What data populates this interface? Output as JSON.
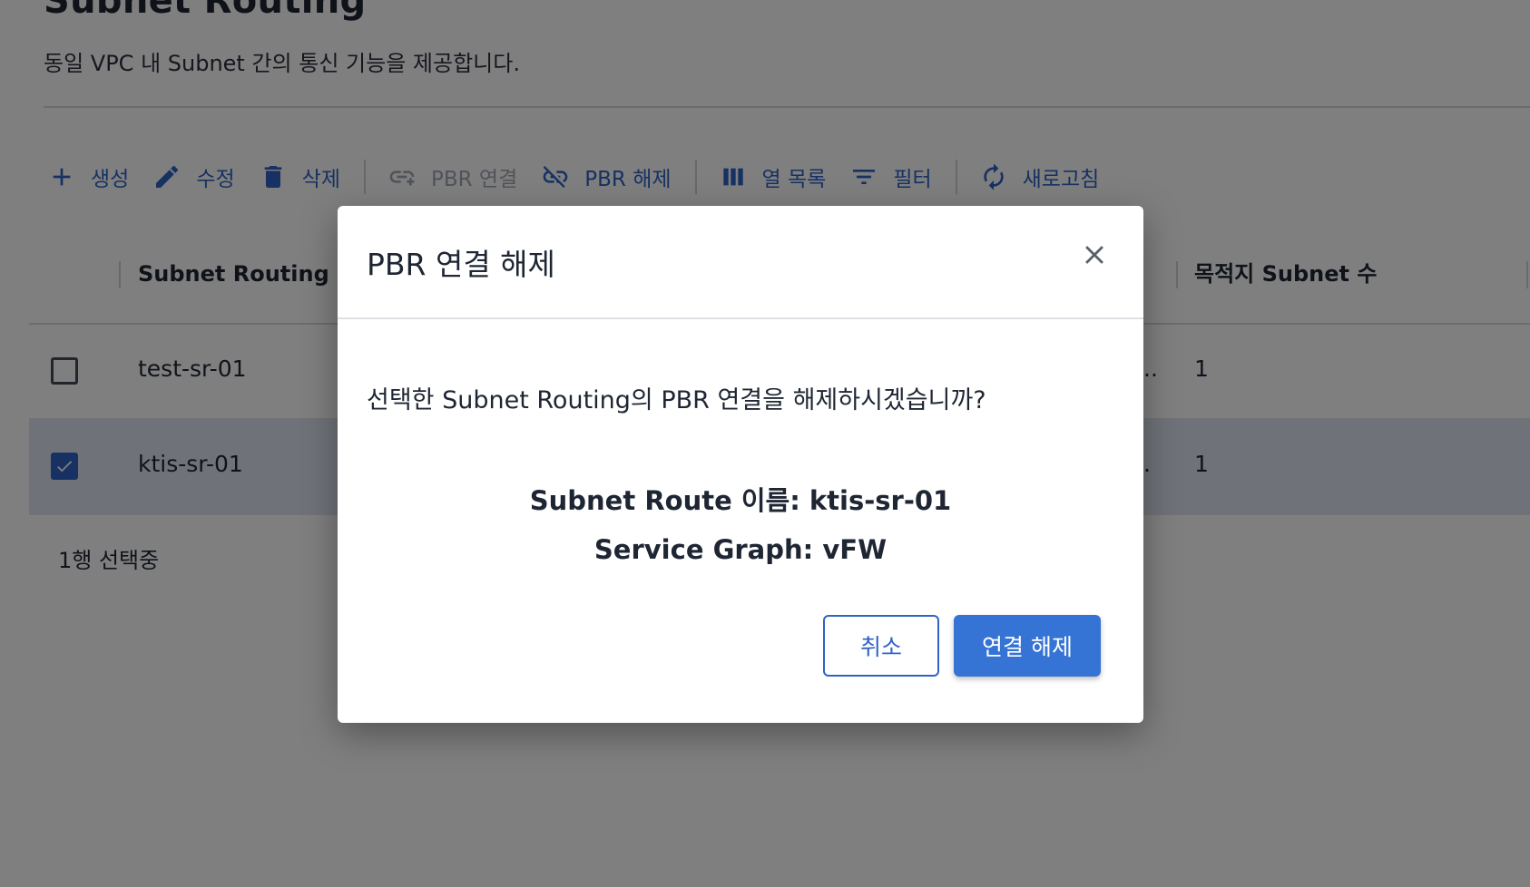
{
  "page": {
    "title": "Subnet Routing",
    "description": "동일 VPC 내 Subnet 간의 통신 기능을 제공합니다."
  },
  "toolbar": {
    "create": "생성",
    "edit": "수정",
    "delete": "삭제",
    "pbr_connect": "PBR 연결",
    "pbr_disconnect": "PBR 해제",
    "columns": "열 목록",
    "filter": "필터",
    "refresh": "새로고침"
  },
  "table": {
    "headers": {
      "name": "Subnet Routing 이",
      "dest_count": "목적지 Subnet 수"
    },
    "rows": [
      {
        "name": "test-sr-01",
        "partial": "..",
        "dest_count": "1",
        "checked": false
      },
      {
        "name": "ktis-sr-01",
        "partial": ".",
        "dest_count": "1",
        "checked": true
      }
    ],
    "selection_text": "1행 선택중"
  },
  "dialog": {
    "title": "PBR 연결 해제",
    "message": "선택한 Subnet Routing의 PBR 연결을 해제하시겠습니까?",
    "route_name_line": "Subnet Route 이름: ktis-sr-01",
    "service_graph_line": "Service Graph: vFW",
    "cancel_label": "취소",
    "confirm_label": "연결 해제"
  },
  "colors": {
    "accent": "#2f63c4",
    "confirm_button": "#3573d5",
    "disabled": "#a0a6b2",
    "selected_row": "#dfe6f2",
    "overlay": "rgba(0,0,0,0.5)"
  },
  "icons": {
    "create": "plus-icon",
    "edit": "pencil-icon",
    "delete": "trash-icon",
    "pbr_connect": "link-icon",
    "pbr_disconnect": "link-off-icon",
    "columns": "columns-icon",
    "filter": "filter-icon",
    "refresh": "refresh-icon",
    "close": "close-icon"
  }
}
